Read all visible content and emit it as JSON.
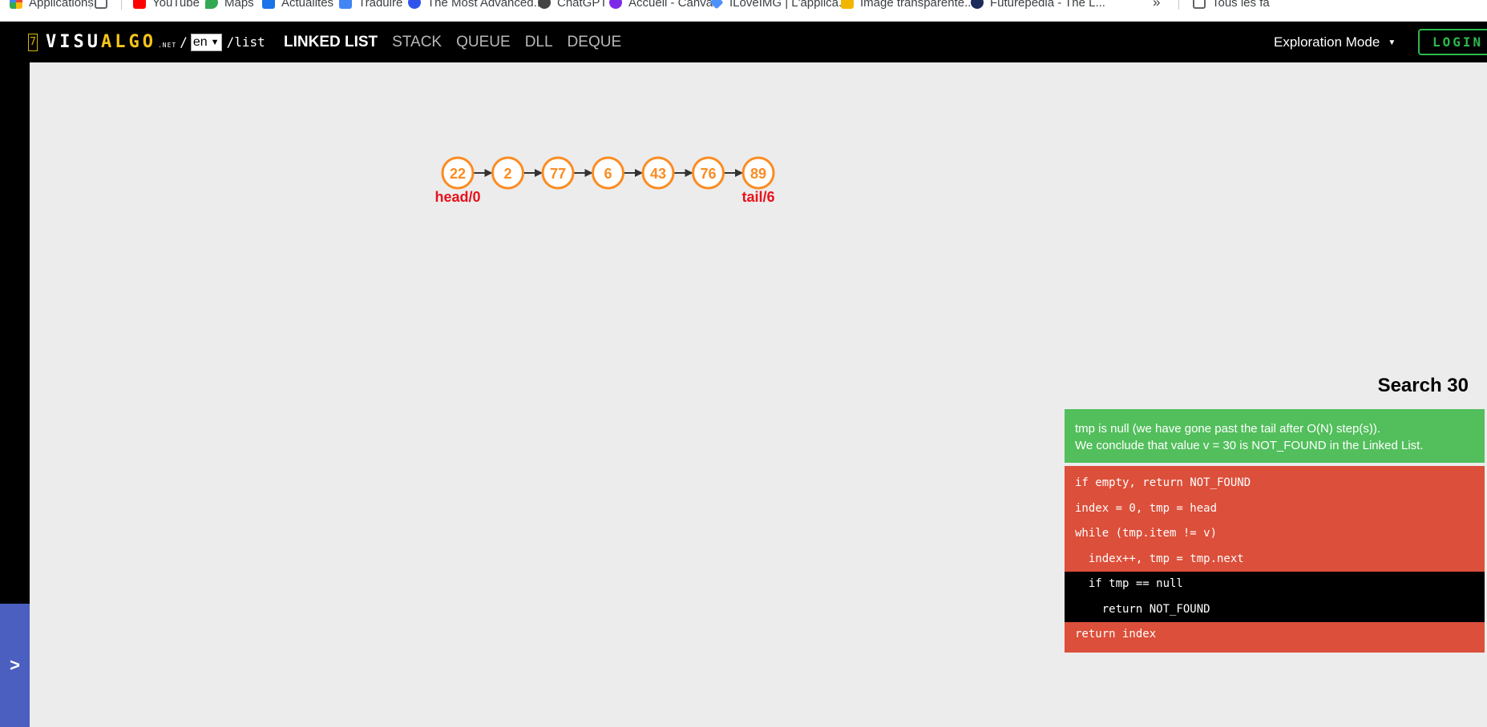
{
  "bookmarks": [
    {
      "label": "Applications",
      "color": "#4285f4"
    },
    {
      "label": "",
      "color": "#5f6368"
    },
    {
      "label": "YouTube",
      "color": "#ff0000"
    },
    {
      "label": "Maps",
      "color": "#34a853"
    },
    {
      "label": "Actualités",
      "color": "#1a73e8"
    },
    {
      "label": "Traduire",
      "color": "#4285f4"
    },
    {
      "label": "The Most Advanced...",
      "color": "#2f54eb"
    },
    {
      "label": "ChatGPT",
      "color": "#444444"
    },
    {
      "label": "Accueil - Canva",
      "color": "#7d2ae8"
    },
    {
      "label": "ILoveIMG | L'applica...",
      "color": "#4d90fe"
    },
    {
      "label": "Image transparente...",
      "color": "#f2b600"
    },
    {
      "label": "Futurepedia - The L...",
      "color": "#1c2b5a"
    }
  ],
  "bookmarks_more": "»",
  "bookmarks_all": "Tous les fa",
  "nav": {
    "logo_seven": "7",
    "logo_visu": "VISU",
    "logo_algo": "ALGO",
    "logo_net": ".NET",
    "slash": "/",
    "lang": "en",
    "path": "/list",
    "links": [
      {
        "label": "LINKED LIST",
        "active": true
      },
      {
        "label": "STACK",
        "active": false
      },
      {
        "label": "QUEUE",
        "active": false
      },
      {
        "label": "DLL",
        "active": false
      },
      {
        "label": "DEQUE",
        "active": false
      }
    ],
    "mode": "Exploration Mode",
    "login": "LOGIN"
  },
  "sidebar": {
    "toggle": ">"
  },
  "list": {
    "nodes": [
      "22",
      "2",
      "77",
      "6",
      "43",
      "76",
      "89"
    ],
    "head_label": "head/0",
    "tail_label": "tail/6"
  },
  "operation": {
    "title": "Search 30",
    "status_line1": "tmp is null (we have gone past the tail after O(N) step(s)).",
    "status_line2": "We conclude that value v = 30 is NOT_FOUND in the Linked List.",
    "code": [
      {
        "text": "if empty, return NOT_FOUND",
        "highlight": false
      },
      {
        "text": "index = 0, tmp = head",
        "highlight": false
      },
      {
        "text": "while (tmp.item != v)",
        "highlight": false
      },
      {
        "text": "  index++, tmp = tmp.next",
        "highlight": false
      },
      {
        "text": "  if tmp == null",
        "highlight": true
      },
      {
        "text": "    return NOT_FOUND",
        "highlight": true
      },
      {
        "text": "return index",
        "highlight": false
      }
    ]
  },
  "colors": {
    "node": "#fb8c22",
    "pointer_label": "#e8121c",
    "status_bg": "#52bf5c",
    "code_bg": "#dc4f3a",
    "code_highlight": "#000000",
    "accent_login": "#2eb84b",
    "sidebar_toggle": "#4a5fbf"
  }
}
